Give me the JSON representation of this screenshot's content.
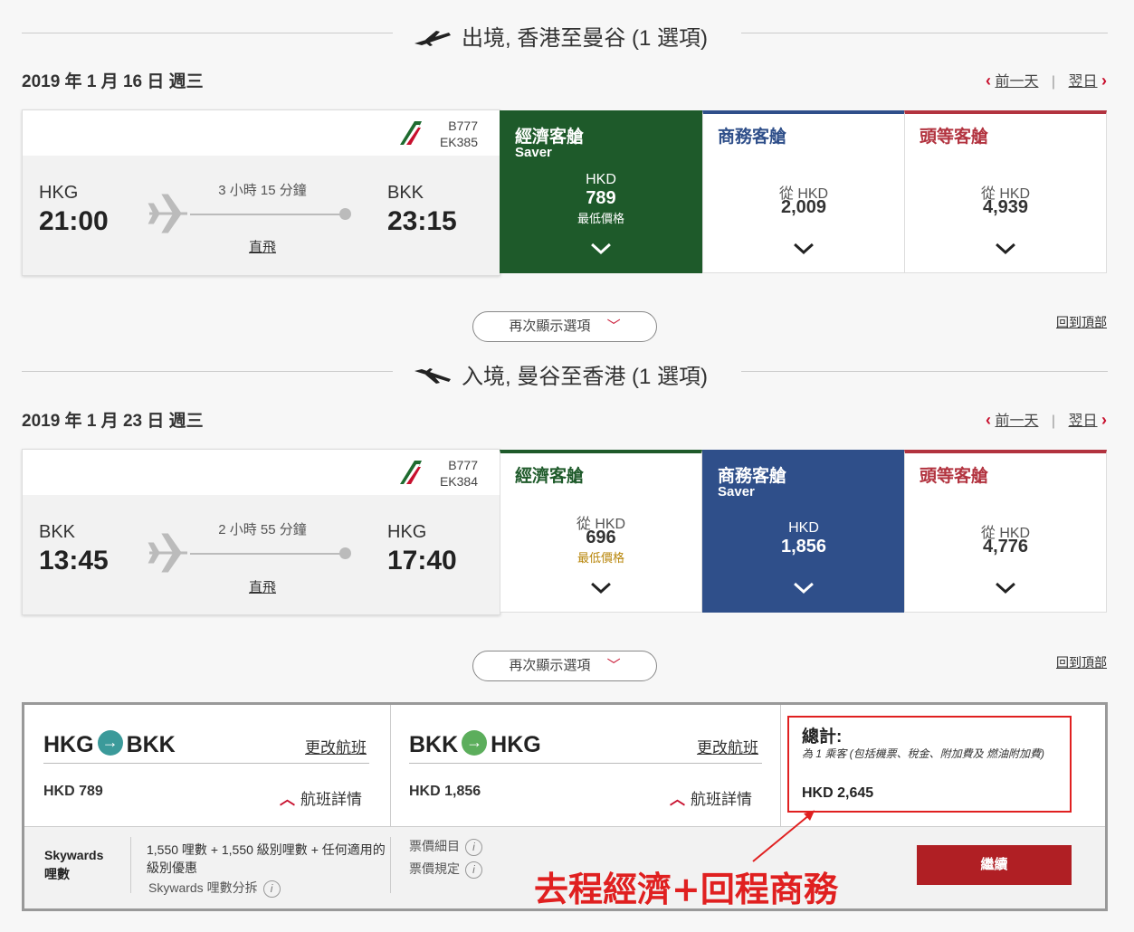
{
  "outbound": {
    "heading": "出境, 香港至曼谷 (1 選項)",
    "date": "2019 年 1 月 16 日 週三",
    "prev_day": "前一天",
    "next_day": "翌日",
    "aircraft": "B777",
    "flight_no": "EK385",
    "origin": "HKG",
    "depart_time": "21:00",
    "destination": "BKK",
    "arrive_time": "23:15",
    "duration": "3 小時 15 分鐘",
    "stops": "直飛",
    "fares": {
      "economy": {
        "label": "經濟客艙",
        "badge": "Saver",
        "currency": "HKD",
        "price": "789",
        "note": "最低價格"
      },
      "business": {
        "label": "商務客艙",
        "from": "從 HKD",
        "price": "2,009"
      },
      "first": {
        "label": "頭等客艙",
        "from": "從 HKD",
        "price": "4,939"
      }
    },
    "show_more": "再次顯示選項",
    "back_to_top": "回到頂部"
  },
  "inbound": {
    "heading": "入境, 曼谷至香港 (1 選項)",
    "date": "2019 年 1 月 23 日 週三",
    "prev_day": "前一天",
    "next_day": "翌日",
    "aircraft": "B777",
    "flight_no": "EK384",
    "origin": "BKK",
    "depart_time": "13:45",
    "destination": "HKG",
    "arrive_time": "17:40",
    "duration": "2 小時 55 分鐘",
    "stops": "直飛",
    "fares": {
      "economy": {
        "label": "經濟客艙",
        "from": "從 HKD",
        "price": "696",
        "note": "最低價格"
      },
      "business": {
        "label": "商務客艙",
        "badge": "Saver",
        "currency": "HKD",
        "price": "1,856"
      },
      "first": {
        "label": "頭等客艙",
        "from": "從 HKD",
        "price": "4,776"
      }
    },
    "show_more": "再次顯示選項",
    "back_to_top": "回到頂部"
  },
  "summary": {
    "out": {
      "from": "HKG",
      "to": "BKK",
      "change": "更改航班",
      "price": "HKD 789",
      "details": "航班詳情"
    },
    "in": {
      "from": "BKK",
      "to": "HKG",
      "change": "更改航班",
      "price": "HKD 1,856",
      "details": "航班詳情"
    },
    "total": {
      "title": "總計:",
      "note": "為 1 乘客 (包括機票、稅金、附加費及 燃油附加費)",
      "price": "HKD 2,645"
    },
    "skywards_label": "Skywards 哩數",
    "skywards_text": "1,550 哩數 + 1,550 級別哩數 + 任何適用的級別優惠",
    "skywards_breakdown": "Skywards 哩數分拆",
    "fare_breakdown": "票價細目",
    "fare_rules": "票價規定",
    "continue": "繼續"
  },
  "annotation": "去程經濟+回程商務",
  "colors": {
    "economy": "#1e5a2a",
    "business": "#2f4f8a",
    "first": "#b2333f",
    "accent": "#c8102e",
    "annotation": "#e02020"
  }
}
